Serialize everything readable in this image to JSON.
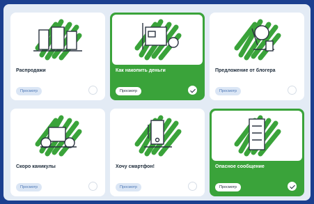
{
  "colors": {
    "background": "#1b3f8f",
    "panel": "#e3ebf5",
    "accent_green": "#3aa33a",
    "card": "#ffffff"
  },
  "cards": [
    {
      "title": "Распродажи",
      "button": "Просмотр",
      "selected": false,
      "icon": "shopping-illustration"
    },
    {
      "title": "Как накопить деньги",
      "button": "Просмотр",
      "selected": true,
      "icon": "savings-illustration"
    },
    {
      "title": "Предложение от блогера",
      "button": "Просмотр",
      "selected": false,
      "icon": "blogger-illustration"
    },
    {
      "title": "Скоро каникулы",
      "button": "Просмотр",
      "selected": false,
      "icon": "vacation-illustration"
    },
    {
      "title": "Хочу смартфон!",
      "button": "Просмотр",
      "selected": false,
      "icon": "smartphone-illustration"
    },
    {
      "title": "Опасное сообщение",
      "button": "Просмотр",
      "selected": true,
      "icon": "dangerous-message-illustration"
    }
  ]
}
